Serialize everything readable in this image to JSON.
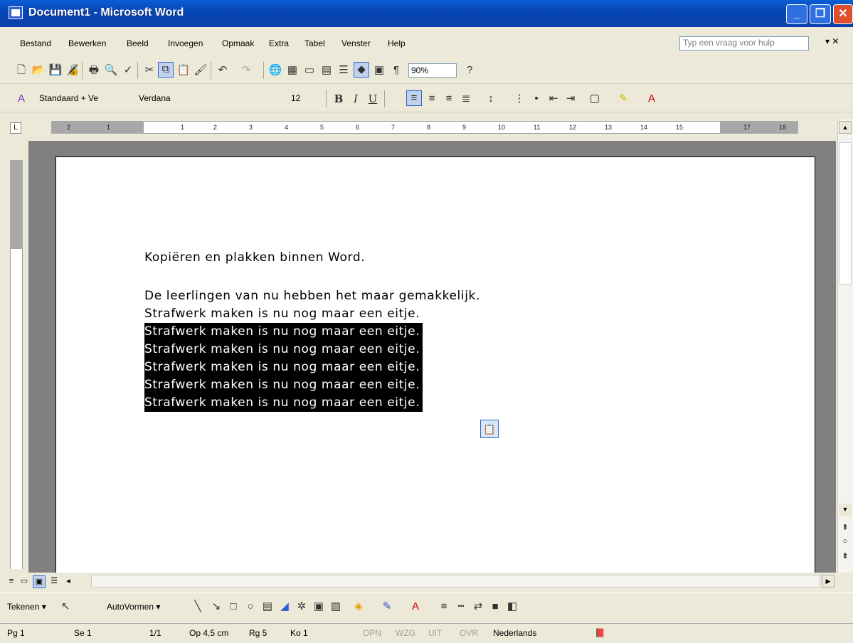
{
  "window": {
    "title": "Document1 - Microsoft Word",
    "min": "_",
    "max": "❐",
    "close": "✕"
  },
  "menu": {
    "items": [
      "Bestand",
      "Bewerken",
      "Beeld",
      "Invoegen",
      "Opmaak",
      "Extra",
      "Tabel",
      "Venster",
      "Help"
    ],
    "help_placeholder": "Typ een vraag voor hulp",
    "close_doc": "▾ ✕"
  },
  "toolbar_standard": {
    "zoom": "90%"
  },
  "toolbar_format": {
    "style": "Standaard + Ve",
    "font": "Verdana",
    "size": "12",
    "bold": "B",
    "italic": "I",
    "underline": "U"
  },
  "ruler": {
    "corner": "L",
    "numbers": [
      "2",
      "1",
      "1",
      "2",
      "3",
      "4",
      "5",
      "6",
      "7",
      "8",
      "9",
      "10",
      "11",
      "12",
      "13",
      "14",
      "15",
      "17",
      "18"
    ]
  },
  "document": {
    "lines": [
      "Kopiëren en plakken binnen Word.",
      "",
      "De leerlingen van nu hebben het maar gemakkelijk.",
      "Strafwerk maken is nu nog maar een eitje."
    ],
    "selected_lines": [
      "Strafwerk maken is nu nog maar een eitje.",
      "Strafwerk maken is nu nog maar een eitje.",
      "Strafwerk maken is nu nog maar een eitje.",
      "Strafwerk maken is nu nog maar een eitje.",
      "Strafwerk maken is nu nog maar een eitje."
    ]
  },
  "drawing": {
    "draw_label": "Tekenen ▾",
    "autoshapes_label": "AutoVormen ▾"
  },
  "status": {
    "page": "Pg 1",
    "section": "Se 1",
    "pages": "1/1",
    "at": "Op 4,5 cm",
    "line": "Rg 5",
    "col": "Ko 1",
    "rec": "OPN",
    "trk": "WZG",
    "ext": "UIT",
    "ovr": "OVR",
    "language": "Nederlands"
  }
}
